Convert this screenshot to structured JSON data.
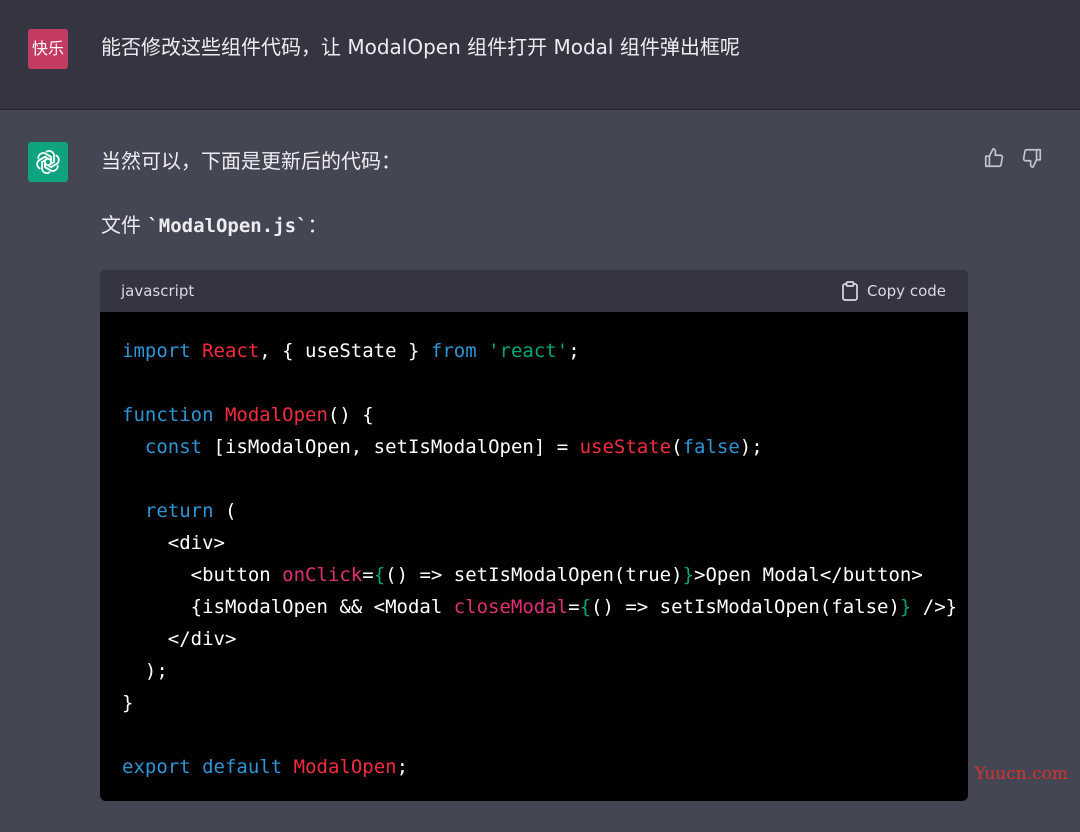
{
  "user": {
    "avatar_text": "快乐",
    "message": "能否修改这些组件代码，让 ModalOpen 组件打开 Modal 组件弹出框呢"
  },
  "assistant": {
    "avatar_icon": "openai-logo-icon",
    "intro": "当然可以，下面是更新后的代码：",
    "file_prefix": "文件 ",
    "file_name": "`ModalOpen.js`",
    "file_suffix": "：",
    "thumbs_up_icon": "thumbs-up-icon",
    "thumbs_down_icon": "thumbs-down-icon"
  },
  "code_block": {
    "language": "javascript",
    "copy_label": "Copy code",
    "lines": [
      [
        [
          "kw",
          "import"
        ],
        [
          "p",
          " "
        ],
        [
          "fn",
          "React"
        ],
        [
          "p",
          ", { useState } "
        ],
        [
          "kw",
          "from"
        ],
        [
          "p",
          " "
        ],
        [
          "str",
          "'react'"
        ],
        [
          "p",
          ";"
        ]
      ],
      [],
      [
        [
          "kw",
          "function"
        ],
        [
          "p",
          " "
        ],
        [
          "fn",
          "ModalOpen"
        ],
        [
          "p",
          "() {"
        ]
      ],
      [
        [
          "p",
          "  "
        ],
        [
          "kw",
          "const"
        ],
        [
          "p",
          " [isModalOpen, setIsModalOpen] = "
        ],
        [
          "fn",
          "useState"
        ],
        [
          "p",
          "("
        ],
        [
          "kw",
          "false"
        ],
        [
          "p",
          ");"
        ]
      ],
      [],
      [
        [
          "p",
          "  "
        ],
        [
          "kw",
          "return"
        ],
        [
          "p",
          " ("
        ]
      ],
      [
        [
          "p",
          "    <div>"
        ]
      ],
      [
        [
          "p",
          "      <button "
        ],
        [
          "attr",
          "onClick"
        ],
        [
          "p",
          "="
        ],
        [
          "br",
          "{"
        ],
        [
          "p",
          "() => setIsModalOpen(true)"
        ],
        [
          "br",
          "}"
        ],
        [
          "p",
          ">Open Modal</button>"
        ]
      ],
      [
        [
          "p",
          "      {isModalOpen && <Modal "
        ],
        [
          "attr",
          "closeModal"
        ],
        [
          "p",
          "="
        ],
        [
          "br",
          "{"
        ],
        [
          "p",
          "() => setIsModalOpen(false)"
        ],
        [
          "br",
          "}"
        ],
        [
          "p",
          " />}"
        ]
      ],
      [
        [
          "p",
          "    </div>"
        ]
      ],
      [
        [
          "p",
          "  );"
        ]
      ],
      [
        [
          "p",
          "}"
        ]
      ],
      [],
      [
        [
          "kw",
          "export"
        ],
        [
          "p",
          " "
        ],
        [
          "kw",
          "default"
        ],
        [
          "p",
          " "
        ],
        [
          "fn",
          "ModalOpen"
        ],
        [
          "p",
          ";"
        ]
      ]
    ]
  },
  "watermark": "Yuucn.com",
  "colors": {
    "user_bg": "#343541",
    "assistant_bg": "#444654",
    "user_avatar": "#c43b62",
    "assistant_avatar": "#10a37f",
    "code_bg": "#000000",
    "code_header_bg": "#343541",
    "keyword": "#2e95d3",
    "function": "#f22c3d",
    "string": "#00a67d",
    "attribute": "#df3079"
  }
}
